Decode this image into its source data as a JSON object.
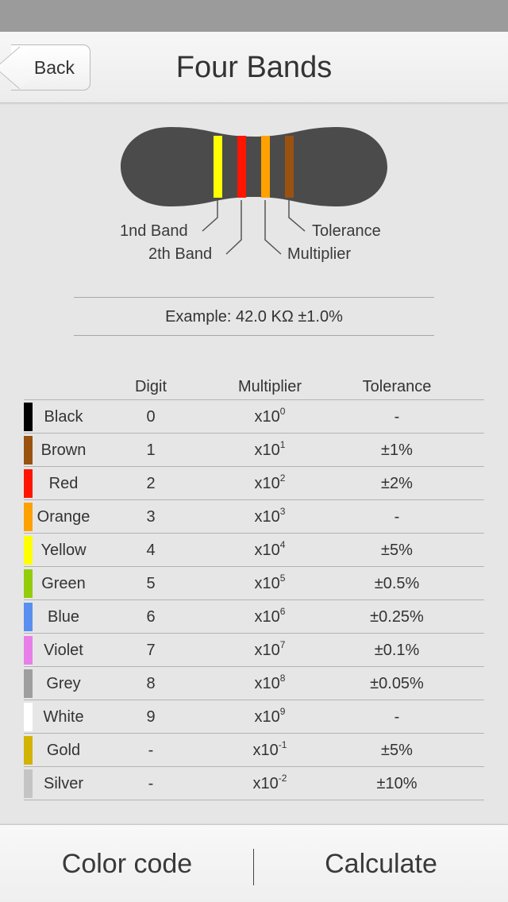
{
  "nav": {
    "back_label": "Back",
    "title": "Four Bands"
  },
  "resistor": {
    "band_colors": [
      "#ffff00",
      "#ff1500",
      "#ffa100",
      "#9a5211"
    ],
    "labels": {
      "first": "1nd Band",
      "second": "2th Band",
      "multiplier": "Multiplier",
      "tolerance": "Tolerance"
    }
  },
  "example": "Example: 42.0 KΩ ±1.0%",
  "table": {
    "headers": {
      "digit": "Digit",
      "multiplier": "Multiplier",
      "tolerance": "Tolerance"
    },
    "rows": [
      {
        "name": "Black",
        "color": "#000000",
        "digit": "0",
        "mult_base": "x10",
        "mult_exp": "0",
        "tolerance": "-"
      },
      {
        "name": "Brown",
        "color": "#9a5211",
        "digit": "1",
        "mult_base": "x10",
        "mult_exp": "1",
        "tolerance": "±1%"
      },
      {
        "name": "Red",
        "color": "#ff1500",
        "digit": "2",
        "mult_base": "x10",
        "mult_exp": "2",
        "tolerance": "±2%"
      },
      {
        "name": "Orange",
        "color": "#ffa100",
        "digit": "3",
        "mult_base": "x10",
        "mult_exp": "3",
        "tolerance": "-"
      },
      {
        "name": "Yellow",
        "color": "#ffff00",
        "digit": "4",
        "mult_base": "x10",
        "mult_exp": "4",
        "tolerance": "±5%"
      },
      {
        "name": "Green",
        "color": "#93cc0a",
        "digit": "5",
        "mult_base": "x10",
        "mult_exp": "5",
        "tolerance": "±0.5%"
      },
      {
        "name": "Blue",
        "color": "#5a8ff0",
        "digit": "6",
        "mult_base": "x10",
        "mult_exp": "6",
        "tolerance": "±0.25%"
      },
      {
        "name": "Violet",
        "color": "#e87fe9",
        "digit": "7",
        "mult_base": "x10",
        "mult_exp": "7",
        "tolerance": "±0.1%"
      },
      {
        "name": "Grey",
        "color": "#9e9e9e",
        "digit": "8",
        "mult_base": "x10",
        "mult_exp": "8",
        "tolerance": "±0.05%"
      },
      {
        "name": "White",
        "color": "#ffffff",
        "digit": "9",
        "mult_base": "x10",
        "mult_exp": "9",
        "tolerance": "-"
      },
      {
        "name": "Gold",
        "color": "#d2b300",
        "digit": "-",
        "mult_base": "x10",
        "mult_exp": "-1",
        "tolerance": "±5%"
      },
      {
        "name": "Silver",
        "color": "#c4c4c4",
        "digit": "-",
        "mult_base": "x10",
        "mult_exp": "-2",
        "tolerance": "±10%"
      }
    ]
  },
  "tabs": {
    "color_code": "Color code",
    "calculate": "Calculate"
  },
  "colors": {
    "status_bar": "#9b9b9b",
    "background": "#e6e6e6",
    "resistor_body": "#4b4b4b"
  }
}
